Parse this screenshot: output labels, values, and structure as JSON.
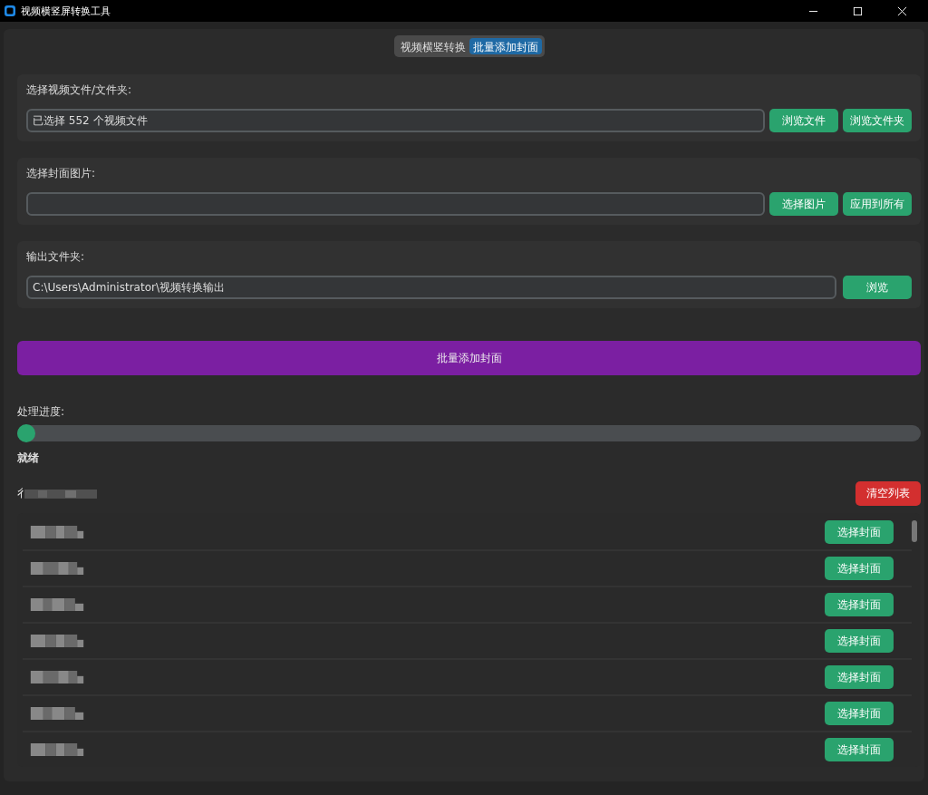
{
  "window": {
    "title": "视频横竖屏转换工具"
  },
  "tabs": [
    {
      "label": "视频横竖转换",
      "selected": false
    },
    {
      "label": "批量添加封面",
      "selected": true
    }
  ],
  "sections": [
    {
      "label": "选择视频文件/文件夹:",
      "value": "已选择 552 个视频文件",
      "buttons": [
        "浏览文件",
        "浏览文件夹"
      ]
    },
    {
      "label": "选择封面图片:",
      "buttons": [
        "选择图片",
        "应用到所有"
      ]
    },
    {
      "label": "输出文件夹:",
      "value": "C:\\Users\\Administrator\\视频转换输出",
      "buttons": [
        "浏览"
      ]
    }
  ],
  "primary_button": "批量添加封面",
  "progress": {
    "label": "处理进度:",
    "level": 0,
    "status": "就绪"
  },
  "list": {
    "label": "彳",
    "clear_button": "清空列表",
    "rows": [
      {
        "button": "选择封面"
      },
      {
        "button": "选择封面"
      },
      {
        "button": "选择封面"
      },
      {
        "button": "选择封面"
      },
      {
        "button": "选择封面"
      },
      {
        "button": "选择封面"
      },
      {
        "button": "选择封面"
      }
    ]
  }
}
